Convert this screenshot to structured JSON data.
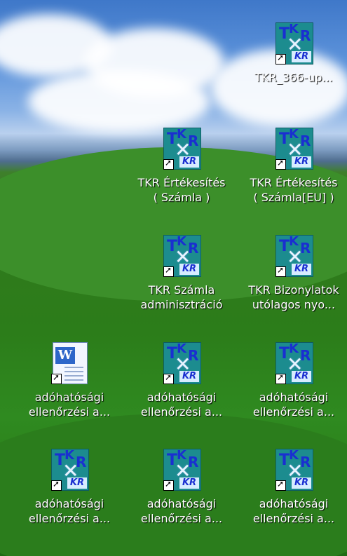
{
  "desktop": {
    "icons": [
      {
        "label1": "TKR_366-up...",
        "label2": ""
      },
      {
        "label1": "TKR Értékesítés",
        "label2": "( Számla )"
      },
      {
        "label1": "TKR Értékesítés",
        "label2": "( Számla[EU] )"
      },
      {
        "label1": "TKR Számla",
        "label2": "adminisztráció"
      },
      {
        "label1": "TKR Bizonylatok",
        "label2": "utólagos nyo..."
      },
      {
        "label1": "adóhatósági",
        "label2": "ellenőrzési a..."
      },
      {
        "label1": "adóhatósági",
        "label2": "ellenőrzési a..."
      },
      {
        "label1": "adóhatósági",
        "label2": "ellenőrzési a..."
      },
      {
        "label1": "adóhatósági",
        "label2": "ellenőrzési a..."
      },
      {
        "label1": "adóhatósági",
        "label2": "ellenőrzési a..."
      },
      {
        "label1": "adóhatósági",
        "label2": "ellenőrzési a..."
      }
    ]
  }
}
